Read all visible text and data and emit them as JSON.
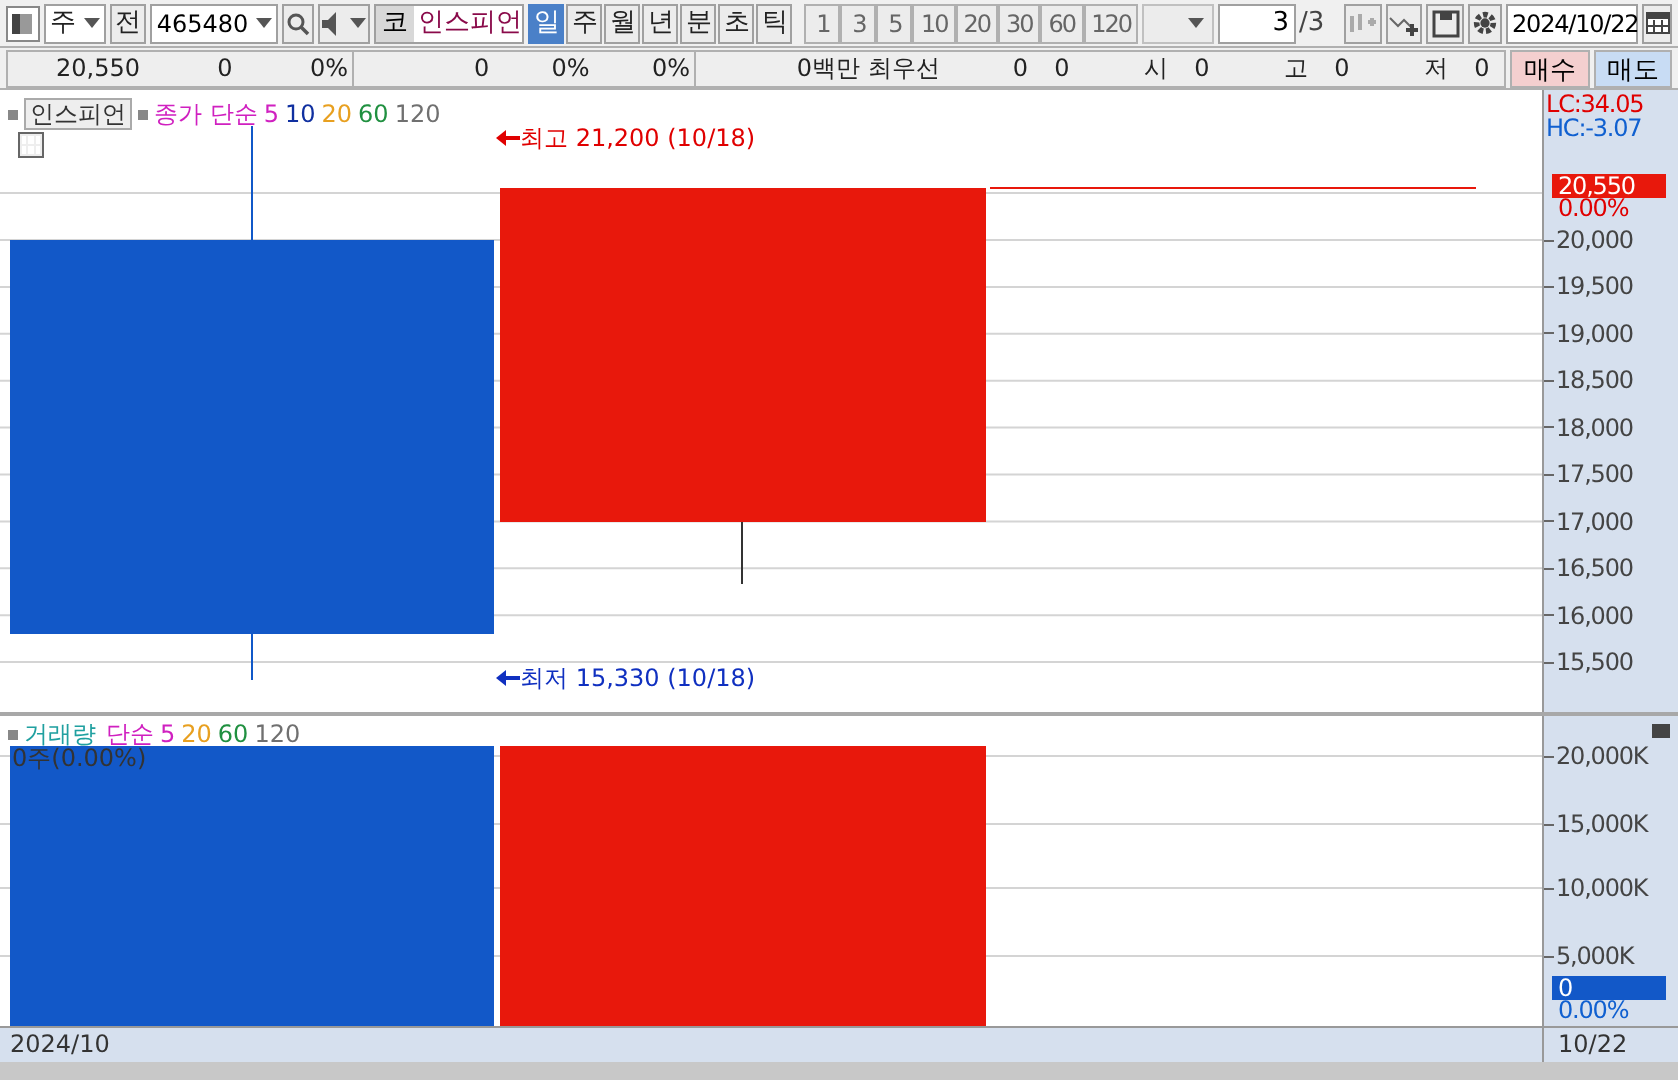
{
  "toolbar": {
    "market": "주",
    "prev_button": "전",
    "code": "465480",
    "name_prefix": "코",
    "name": "인스피언",
    "periods": [
      {
        "label": "일",
        "selected": true
      },
      {
        "label": "주",
        "selected": false
      },
      {
        "label": "월",
        "selected": false
      },
      {
        "label": "년",
        "selected": false
      },
      {
        "label": "분",
        "selected": false
      },
      {
        "label": "초",
        "selected": false
      },
      {
        "label": "틱",
        "selected": false
      }
    ],
    "intervals": [
      "1",
      "3",
      "5",
      "10",
      "20",
      "30",
      "60",
      "120"
    ],
    "page": "3",
    "page_total": "/3",
    "date": "2024/10/22"
  },
  "quote_bar": {
    "groups": [
      [
        "20,550",
        "0",
        "0%"
      ],
      [
        "0",
        "0%",
        "0%"
      ],
      [
        "0백만",
        "최우선",
        "0",
        "0",
        "시",
        "0",
        "고",
        "0",
        "저",
        "0"
      ]
    ],
    "buy_button": "매수",
    "sell_button": "매도"
  },
  "price_pane": {
    "name": "인스피언",
    "indicator": "종가 단순",
    "moving_averages": [
      {
        "label": "5",
        "color": "#d020c0"
      },
      {
        "label": "10",
        "color": "#1030a0"
      },
      {
        "label": "20",
        "color": "#e8a020"
      },
      {
        "label": "60",
        "color": "#209040"
      },
      {
        "label": "120",
        "color": "#707070"
      }
    ],
    "high_label": "최고 21,200 (10/18)",
    "low_label": "최저 15,330 (10/18)",
    "lc": "LC:34.05",
    "hc": "HC:-3.07",
    "ticks": [
      "20,000",
      "19,500",
      "19,000",
      "18,500",
      "18,000",
      "17,500",
      "17,000",
      "16,500",
      "16,000",
      "15,500"
    ],
    "current_price": "20,550",
    "current_change": "0.00%"
  },
  "volume_pane": {
    "name": "거래량",
    "indicator": "단순",
    "moving_averages": [
      {
        "label": "5",
        "color": "#d020c0"
      },
      {
        "label": "20",
        "color": "#e8a020"
      },
      {
        "label": "60",
        "color": "#209040"
      },
      {
        "label": "120",
        "color": "#707070"
      }
    ],
    "legend": "0주(0.00%)",
    "ticks": [
      "20,000K",
      "15,000K",
      "10,000K",
      "5,000K"
    ],
    "current_volume": "0",
    "current_change": "0.00%"
  },
  "footer": {
    "period": "2024/10",
    "date": "10/22"
  }
}
